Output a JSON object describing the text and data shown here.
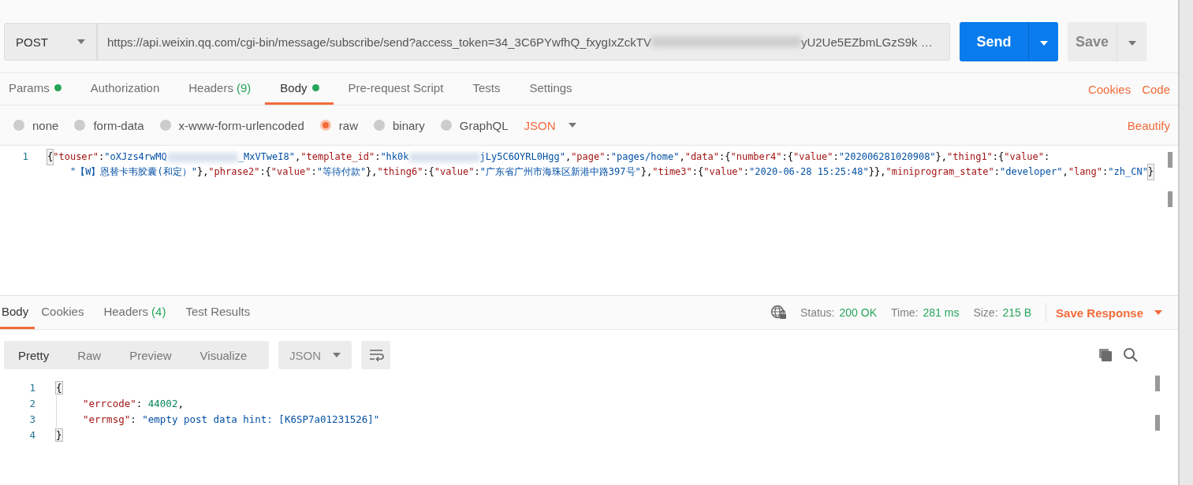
{
  "request": {
    "method": "POST",
    "url_start": "https://api.weixin.qq.com/cgi-bin/message/subscribe/send?access_token=34_3C6PYwfhQ_fxygIxZckTV",
    "url_end": "yU2Ue5EZbmLGzS9k …",
    "send": "Send",
    "save": "Save"
  },
  "request_tabs": [
    {
      "label": "Params",
      "has_content": true,
      "selected": false
    },
    {
      "label": "Authorization",
      "has_content": false,
      "selected": false
    },
    {
      "label": "Headers",
      "count": "(9)",
      "has_content": false,
      "selected": false
    },
    {
      "label": "Body",
      "has_content": true,
      "selected": true
    },
    {
      "label": "Pre-request Script",
      "has_content": false,
      "selected": false
    },
    {
      "label": "Tests",
      "has_content": false,
      "selected": false
    },
    {
      "label": "Settings",
      "has_content": false,
      "selected": false
    }
  ],
  "request_links": [
    "Cookies",
    "Code"
  ],
  "body_types": [
    {
      "label": "none",
      "selected": false
    },
    {
      "label": "form-data",
      "selected": false
    },
    {
      "label": "x-www-form-urlencoded",
      "selected": false
    },
    {
      "label": "raw",
      "selected": true
    },
    {
      "label": "binary",
      "selected": false
    },
    {
      "label": "GraphQL",
      "selected": false
    }
  ],
  "body_format": "JSON",
  "beautify": "Beautify",
  "request_body": {
    "line_number": "1",
    "tokens": [
      {
        "kind": "match",
        "text": "{"
      },
      {
        "kind": "key",
        "text": "\"touser\""
      },
      {
        "kind": "punct",
        "text": ":"
      },
      {
        "kind": "string",
        "text": "\"oXJzs4rwMQ"
      },
      {
        "kind": "blur"
      },
      {
        "kind": "string",
        "text": "_MxVTweI8\""
      },
      {
        "kind": "punct",
        "text": ","
      },
      {
        "kind": "key",
        "text": "\"template_id\""
      },
      {
        "kind": "punct",
        "text": ":"
      },
      {
        "kind": "string",
        "text": "\"hk0k"
      },
      {
        "kind": "blur"
      },
      {
        "kind": "string",
        "text": "jLy5C6OYRL0Hgg\""
      },
      {
        "kind": "punct",
        "text": ","
      },
      {
        "kind": "key",
        "text": "\"page\""
      },
      {
        "kind": "punct",
        "text": ":"
      },
      {
        "kind": "string",
        "text": "\"pages/home\""
      },
      {
        "kind": "punct",
        "text": ","
      },
      {
        "kind": "key",
        "text": "\"data\""
      },
      {
        "kind": "punct",
        "text": ":{"
      },
      {
        "kind": "key",
        "text": "\"number4\""
      },
      {
        "kind": "punct",
        "text": ":{"
      },
      {
        "kind": "key",
        "text": "\"value\""
      },
      {
        "kind": "punct",
        "text": ":"
      },
      {
        "kind": "string",
        "text": "\"202006281020908\""
      },
      {
        "kind": "punct",
        "text": "},"
      },
      {
        "kind": "key",
        "text": "\"thing1\""
      },
      {
        "kind": "punct",
        "text": ":{"
      },
      {
        "kind": "key",
        "text": "\"value\""
      },
      {
        "kind": "punct",
        "text": ":"
      },
      {
        "kind": "string",
        "text": "\"【W】恩替卡韦胶囊(和定）\""
      },
      {
        "kind": "punct",
        "text": "},"
      },
      {
        "kind": "key",
        "text": "\"phrase2\""
      },
      {
        "kind": "punct",
        "text": ":{"
      },
      {
        "kind": "key",
        "text": "\"value\""
      },
      {
        "kind": "punct",
        "text": ":"
      },
      {
        "kind": "string",
        "text": "\"等待付款\""
      },
      {
        "kind": "punct",
        "text": "},"
      },
      {
        "kind": "key",
        "text": "\"thing6\""
      },
      {
        "kind": "punct",
        "text": ":{"
      },
      {
        "kind": "key",
        "text": "\"value\""
      },
      {
        "kind": "punct",
        "text": ":"
      },
      {
        "kind": "string",
        "text": "\"广东省广州市海珠区新港中路397号\""
      },
      {
        "kind": "punct",
        "text": "},"
      },
      {
        "kind": "key",
        "text": "\"time3\""
      },
      {
        "kind": "punct",
        "text": ":{"
      },
      {
        "kind": "key",
        "text": "\"value\""
      },
      {
        "kind": "punct",
        "text": ":"
      },
      {
        "kind": "string",
        "text": "\"2020-06-28 15:25:48\""
      },
      {
        "kind": "punct",
        "text": "}},"
      },
      {
        "kind": "key",
        "text": "\"miniprogram_state\""
      },
      {
        "kind": "punct",
        "text": ":"
      },
      {
        "kind": "string",
        "text": "\"developer\""
      },
      {
        "kind": "punct",
        "text": ","
      },
      {
        "kind": "key",
        "text": "\"lang\""
      },
      {
        "kind": "punct",
        "text": ":"
      },
      {
        "kind": "string",
        "text": "\"zh_CN\""
      },
      {
        "kind": "match",
        "text": "}"
      }
    ]
  },
  "response_tabs": [
    {
      "label": "Body",
      "selected": true
    },
    {
      "label": "Cookies",
      "selected": false
    },
    {
      "label": "Headers",
      "count": "(4)",
      "selected": false
    },
    {
      "label": "Test Results",
      "selected": false
    }
  ],
  "response_meta": {
    "status_label": "Status:",
    "status": "200 OK",
    "time_label": "Time:",
    "time": "281 ms",
    "size_label": "Size:",
    "size": "215 B",
    "save_response": "Save Response"
  },
  "view_modes": [
    {
      "label": "Pretty",
      "selected": true
    },
    {
      "label": "Raw",
      "selected": false
    },
    {
      "label": "Preview",
      "selected": false
    },
    {
      "label": "Visualize",
      "selected": false
    }
  ],
  "response_format": "JSON",
  "response_lines": [
    {
      "number": "1",
      "kind": "bracket",
      "tokens": [
        {
          "kind": "match",
          "text": "{"
        }
      ]
    },
    {
      "number": "2",
      "kind": "member",
      "tokens": [
        {
          "kind": "key",
          "text": "\"errcode\""
        },
        {
          "kind": "punct",
          "text": ": "
        },
        {
          "kind": "number",
          "text": "44002"
        },
        {
          "kind": "punct",
          "text": ","
        }
      ]
    },
    {
      "number": "3",
      "kind": "member",
      "tokens": [
        {
          "kind": "key",
          "text": "\"errmsg\""
        },
        {
          "kind": "punct",
          "text": ": "
        },
        {
          "kind": "string",
          "text": "\"empty post data hint: [K6SP7a01231526]\""
        }
      ]
    },
    {
      "number": "4",
      "kind": "bracket",
      "tokens": [
        {
          "kind": "match",
          "text": "}"
        }
      ]
    }
  ]
}
